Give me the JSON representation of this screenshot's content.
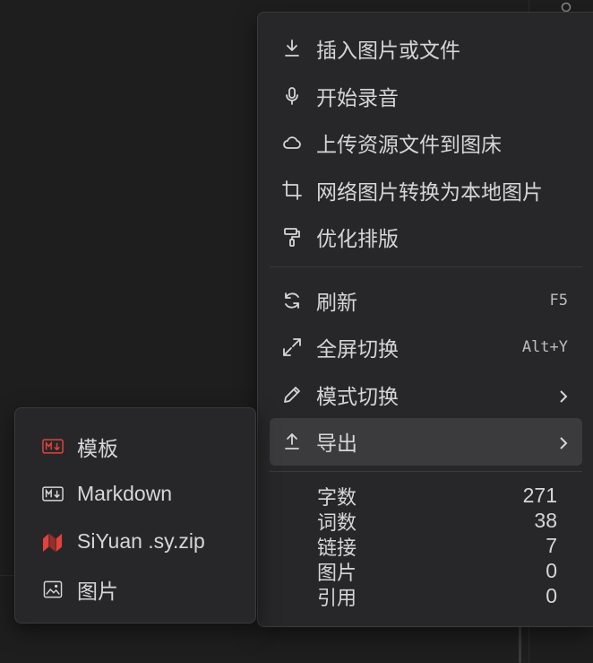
{
  "main_menu": {
    "items": [
      {
        "label": "插入图片或文件",
        "icon": "download-icon"
      },
      {
        "label": "开始录音",
        "icon": "microphone-icon"
      },
      {
        "label": "上传资源文件到图床",
        "icon": "cloud-icon"
      },
      {
        "label": "网络图片转换为本地图片",
        "icon": "crop-icon"
      },
      {
        "label": "优化排版",
        "icon": "paint-roller-icon"
      },
      {
        "label": "刷新",
        "icon": "refresh-icon",
        "shortcut": "F5"
      },
      {
        "label": "全屏切换",
        "icon": "fullscreen-icon",
        "shortcut": "Alt+Y"
      },
      {
        "label": "模式切换",
        "icon": "pencil-icon",
        "has_submenu": true
      },
      {
        "label": "导出",
        "icon": "upload-icon",
        "has_submenu": true,
        "active": true
      }
    ]
  },
  "stats": [
    {
      "label": "字数",
      "value": "271"
    },
    {
      "label": "词数",
      "value": "38"
    },
    {
      "label": "链接",
      "value": "7"
    },
    {
      "label": "图片",
      "value": "0"
    },
    {
      "label": "引用",
      "value": "0"
    }
  ],
  "export_submenu": {
    "items": [
      {
        "label": "模板",
        "icon": "markdown-template-icon"
      },
      {
        "label": "Markdown",
        "icon": "markdown-icon"
      },
      {
        "label": "SiYuan .sy.zip",
        "icon": "siyuan-logo-icon"
      },
      {
        "label": "图片",
        "icon": "image-icon"
      }
    ]
  },
  "colors": {
    "menu_bg": "#272729",
    "active_bg": "#3b3b3e",
    "text": "#d6d6d6",
    "accent_red": "#e0433d"
  }
}
